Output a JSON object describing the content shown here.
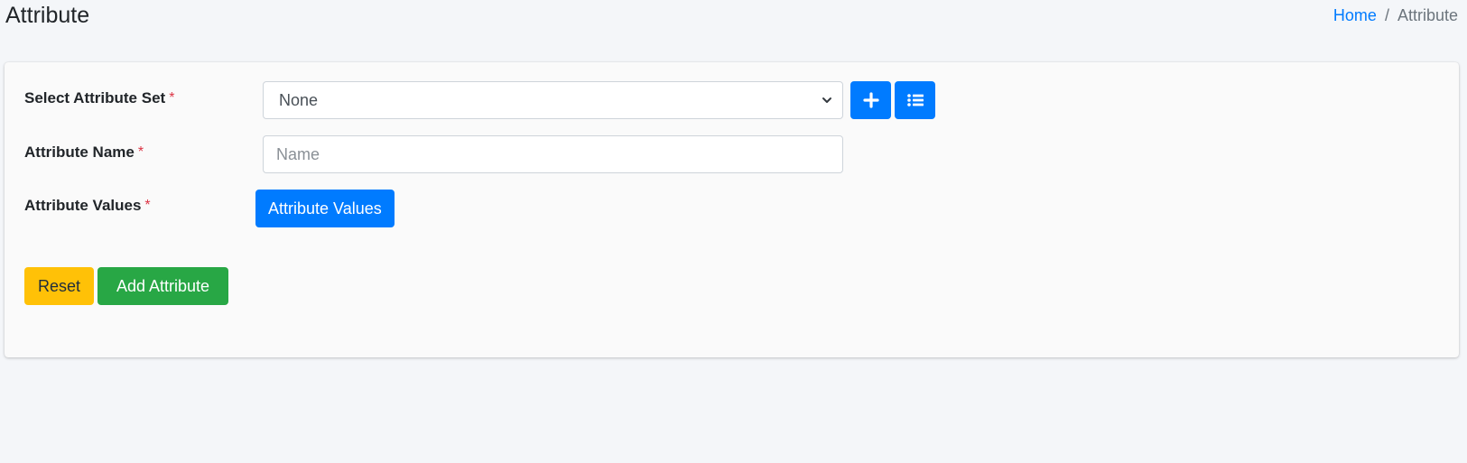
{
  "header": {
    "title": "Attribute",
    "breadcrumb": {
      "home": "Home",
      "separator": "/",
      "current": "Attribute"
    }
  },
  "form": {
    "attribute_set": {
      "label": "Select Attribute Set",
      "required_mark": "*",
      "selected": "None",
      "add_icon": "plus-icon",
      "list_icon": "list-icon"
    },
    "attribute_name": {
      "label": "Attribute Name",
      "required_mark": "*",
      "value": "",
      "placeholder": "Name"
    },
    "attribute_values": {
      "label": "Attribute Values",
      "required_mark": "*",
      "button_label": "Attribute Values"
    },
    "actions": {
      "reset_label": "Reset",
      "submit_label": "Add Attribute"
    }
  },
  "colors": {
    "primary": "#007bff",
    "warning": "#ffc107",
    "success": "#28a745",
    "required": "#dc3545",
    "page_bg": "#f4f6f9"
  }
}
